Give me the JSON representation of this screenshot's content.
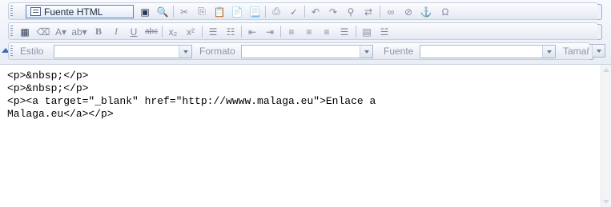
{
  "toolbar": {
    "source_label": "Fuente HTML",
    "row1_icons": [
      "preview-icon",
      "search-doc-icon",
      "cut-icon",
      "copy-icon",
      "paste-icon",
      "paste-text-icon",
      "paste-word-icon",
      "print-icon",
      "spellcheck-icon",
      "undo-icon",
      "redo-icon",
      "find-icon",
      "replace-icon",
      "link-icon",
      "unlink-icon",
      "anchor-icon",
      "special-char-icon"
    ],
    "row2_icons": [
      "table-icon",
      "eraser-icon",
      "text-color-icon",
      "highlight-icon",
      "bold-icon",
      "italic-icon",
      "underline-icon",
      "strikethrough-icon",
      "subscript-icon",
      "superscript-icon",
      "numbered-list-icon",
      "bullet-list-icon",
      "outdent-icon",
      "indent-icon",
      "align-left-icon",
      "align-center-icon",
      "align-right-icon",
      "align-justify-icon",
      "block-icon",
      "hr-icon"
    ],
    "style_label": "Estilo",
    "format_label": "Formato",
    "font_label": "Fuente",
    "size_label": "Tamaño"
  },
  "editor": {
    "lines": [
      "<p>&nbsp;</p>",
      "<p>&nbsp;</p>",
      "<p><a target=\"_blank\" href=\"http://wwww.malaga.eu\">Enlace a",
      "Malaga.eu</a></p>"
    ]
  }
}
